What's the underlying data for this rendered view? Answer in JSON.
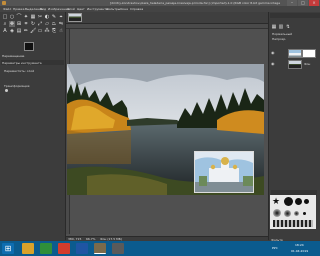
{
  "window": {
    "title": "[dmitry-kondrashov-plaza_heladeria_paisaje-krasivaja-priroda-fon] (imported)-1.0 (RGB color 8-bit gamma integer, GIMP built-in sRGB, 1 layer) 1920x1200 – GIMP"
  },
  "menu": [
    "Файл",
    "Правка",
    "Выделение",
    "Вид",
    "Изображение",
    "Слой",
    "Цвет",
    "Инструменты",
    "Фильтры",
    "Окна",
    "Справка"
  ],
  "left_dock": {
    "panel_label": "Перемещение",
    "options_title": "Параметры инструмента",
    "mode_label": "Переместить: слой",
    "transform_label": "Трансформация"
  },
  "canvas": {
    "zoom": "66.7%",
    "status_text": "Фон (17.5 МБ)",
    "coord_readout": "380, 715"
  },
  "right_dock": {
    "layers_mode": "Нормальный",
    "opacity_label": "Непрозр.",
    "layer_name": "Фон",
    "brush_label": "2. Hardness 050 (51 x 51)",
    "brush_filter": "Фильтр"
  },
  "taskbar": {
    "time": "18:24",
    "date": "01.04.2019",
    "lang": "РУС"
  },
  "colors": {
    "accent": "#0b5b8e",
    "panel": "#3c3c3c",
    "canvas_bg": "#505050"
  }
}
